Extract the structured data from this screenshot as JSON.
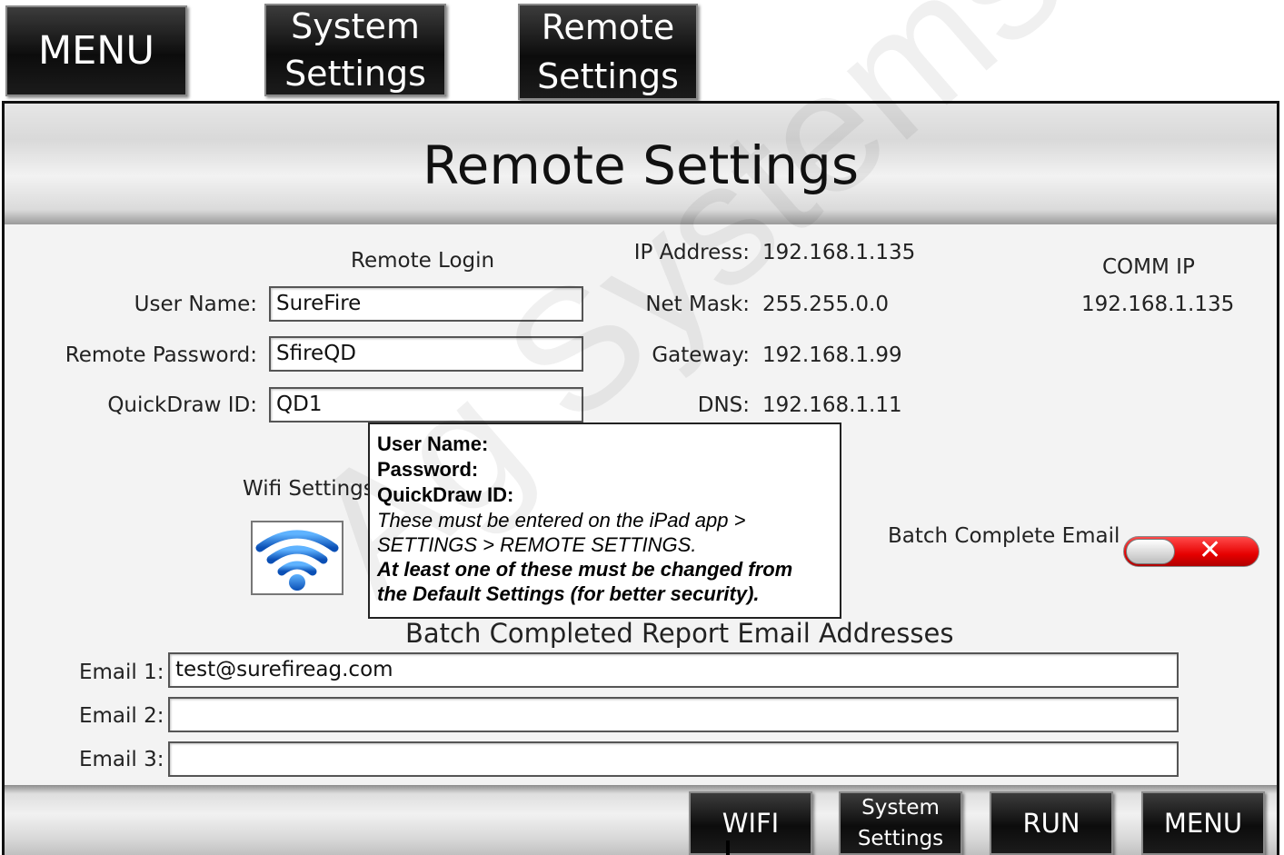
{
  "top_nav": {
    "menu": "MENU",
    "system_settings": [
      "System",
      "Settings"
    ],
    "remote_settings": [
      "Remote",
      "Settings"
    ]
  },
  "page": {
    "title": "Remote Settings"
  },
  "remote_login": {
    "heading": "Remote Login",
    "user_name_label": "User Name:",
    "user_name_value": "SureFire",
    "password_label": "Remote Password:",
    "password_value": "SfireQD",
    "quickdraw_label": "QuickDraw ID:",
    "quickdraw_value": "QD1"
  },
  "network": {
    "ip_label": "IP Address:",
    "ip_value": "192.168.1.135",
    "mask_label": "Net Mask:",
    "mask_value": "255.255.0.0",
    "gateway_label": "Gateway:",
    "gateway_value": "192.168.1.99",
    "dns_label": "DNS:",
    "dns_value": "192.168.1.11"
  },
  "comm": {
    "label": "COMM IP",
    "value": "192.168.1.135"
  },
  "wifi": {
    "label": "Wifi Settings",
    "icon": "wifi-icon"
  },
  "batch_email": {
    "toggle_label": "Batch Complete Email",
    "toggle_state": "off",
    "toggle_off_color": "#e60000",
    "report_heading": "Batch Completed Report Email Addresses",
    "email1_label": "Email 1:",
    "email1_value": "test@surefireag.com",
    "email2_label": "Email 2:",
    "email2_value": "",
    "email3_label": "Email 3:",
    "email3_value": ""
  },
  "note": {
    "line1": "User Name:",
    "line2": "Password:",
    "line3": "QuickDraw ID:",
    "line4": "These must be entered on the iPad app >",
    "line5": "SETTINGS > REMOTE SETTINGS.",
    "line6": "At least one of these must be changed from",
    "line7": "the Default Settings (for better security)."
  },
  "footer_nav": {
    "wifi": "WIFI",
    "system_settings": [
      "System",
      "Settings"
    ],
    "run": "RUN",
    "menu": "MENU"
  },
  "watermark": "Ag Systems"
}
